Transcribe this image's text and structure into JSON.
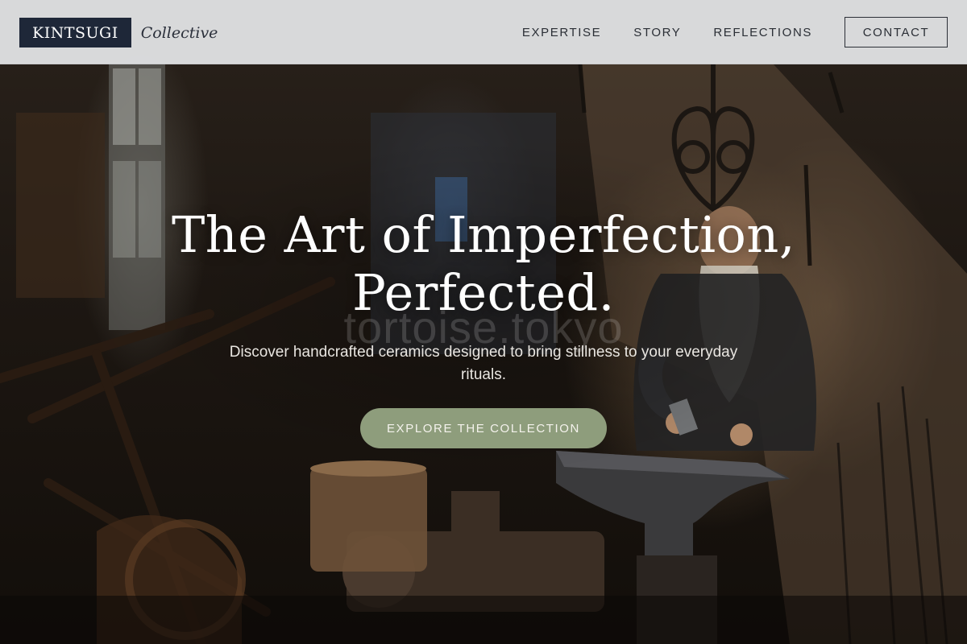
{
  "brand": {
    "name": "KINTSUGI",
    "tagline": "Collective"
  },
  "nav": {
    "items": [
      {
        "label": "EXPERTISE"
      },
      {
        "label": "STORY"
      },
      {
        "label": "REFLECTIONS"
      }
    ],
    "contact_label": "CONTACT"
  },
  "hero": {
    "title_line1": "The Art of Imperfection,",
    "title_line2": "Perfected.",
    "subtitle": "Discover handcrafted ceramics designed to bring stillness to your everyday rituals.",
    "cta_label": "EXPLORE THE COLLECTION",
    "watermark": "tortoise.tokyo"
  },
  "colors": {
    "logo_bg": "#1e2738",
    "header_bg": "#dedfe1",
    "accent_green": "#8e9d7c",
    "text_dark": "#2b2f36"
  }
}
